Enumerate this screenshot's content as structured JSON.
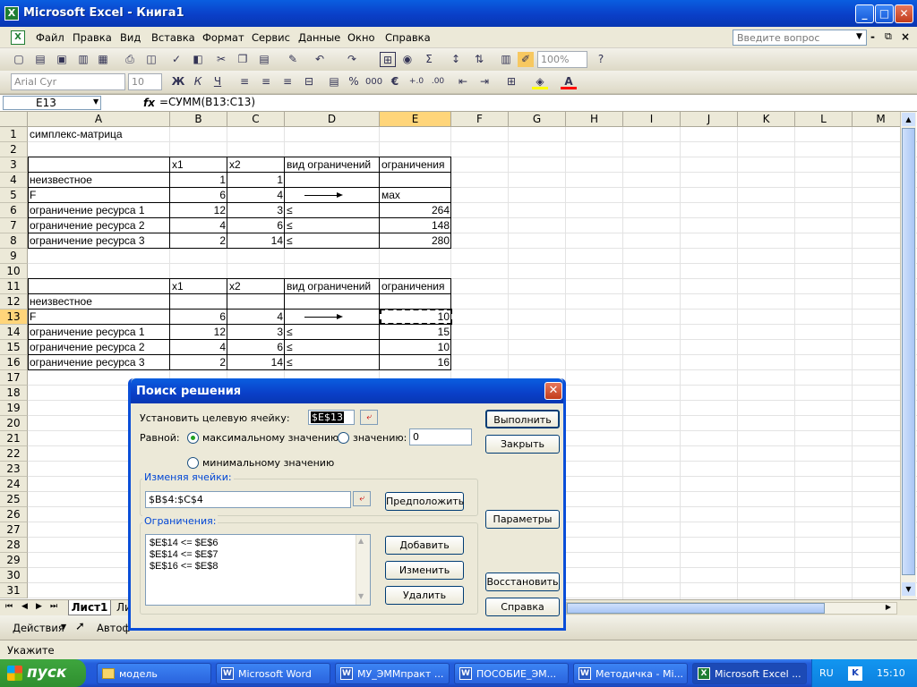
{
  "window": {
    "title": "Microsoft Excel - Книга1"
  },
  "menu": {
    "items": [
      "Файл",
      "Правка",
      "Вид",
      "Вставка",
      "Формат",
      "Сервис",
      "Данные",
      "Окно",
      "Справка"
    ],
    "help_placeholder": "Введите вопрос"
  },
  "toolbar": {
    "zoom": "100%",
    "font": "Arial Cyr",
    "size": "10"
  },
  "formula_bar": {
    "name_box": "E13",
    "fx": "fx",
    "formula": "=СУММ(B13:C13)"
  },
  "grid": {
    "columns": [
      "A",
      "B",
      "C",
      "D",
      "E",
      "F",
      "G",
      "H",
      "I",
      "J",
      "K",
      "L",
      "M"
    ],
    "rows": [
      "1",
      "2",
      "3",
      "4",
      "5",
      "6",
      "7",
      "8",
      "9",
      "10",
      "11",
      "12",
      "13",
      "14",
      "15",
      "16",
      "17",
      "18",
      "19",
      "20",
      "21",
      "22",
      "23",
      "24",
      "25",
      "26",
      "27",
      "28",
      "29",
      "30",
      "31"
    ],
    "selected_row": "13",
    "selected_col": "E",
    "cells": {
      "r1": {
        "a": "симплекс-матрица"
      },
      "r3": {
        "b": "x1",
        "c": "x2",
        "d": "вид ограничений",
        "e": "ограничения"
      },
      "r4": {
        "a": "неизвестное",
        "b": "1",
        "c": "1"
      },
      "r5": {
        "a": "F",
        "b": "6",
        "c": "4",
        "e": "мах"
      },
      "r6": {
        "a": "ограничение ресурса 1",
        "b": "12",
        "c": "3",
        "d": "≤",
        "e": "264"
      },
      "r7": {
        "a": "ограничение ресурса 2",
        "b": "4",
        "c": "6",
        "d": "≤",
        "e": "148"
      },
      "r8": {
        "a": "ограничение ресурса 3",
        "b": "2",
        "c": "14",
        "d": "≤",
        "e": "280"
      },
      "r11": {
        "b": "x1",
        "c": "x2",
        "d": "вид ограничений",
        "e": "ограничения"
      },
      "r12": {
        "a": "неизвестное"
      },
      "r13": {
        "a": "F",
        "b": "6",
        "c": "4",
        "e": "10"
      },
      "r14": {
        "a": "ограничение ресурса 1",
        "b": "12",
        "c": "3",
        "d": "≤",
        "e": "15"
      },
      "r15": {
        "a": "ограничение ресурса 2",
        "b": "4",
        "c": "6",
        "d": "≤",
        "e": "10"
      },
      "r16": {
        "a": "ограничение ресурса 3",
        "b": "2",
        "c": "14",
        "d": "≤",
        "e": "16"
      }
    }
  },
  "sheet_tabs": [
    "Лист1",
    "Ли"
  ],
  "draw_toolbar": {
    "actions": "Действия",
    "autoshapes": "Автоф"
  },
  "status": {
    "text": "Укажите"
  },
  "dialog": {
    "title": "Поиск решения",
    "target_label": "Установить целевую ячейку:",
    "target_value": "$E$13",
    "equal_label": "Равной:",
    "opt_max": "максимальному значению",
    "opt_value": "значению:",
    "value_field": "0",
    "opt_min": "минимальному значению",
    "changing_label": "Изменяя ячейки:",
    "changing_value": "$B$4:$C$4",
    "guess_button": "Предположить",
    "constraints_label": "Ограничения:",
    "constraints": [
      "$E$14 <= $E$6",
      "$E$14 <= $E$7",
      "$E$16 <= $E$8"
    ],
    "add_button": "Добавить",
    "change_button": "Изменить",
    "delete_button": "Удалить",
    "solve_button": "Выполнить",
    "close_button": "Закрыть",
    "options_button": "Параметры",
    "reset_button": "Восстановить",
    "help_button": "Справка"
  },
  "taskbar": {
    "start": "пуск",
    "tasks": [
      "модель",
      "Microsoft Word",
      "МУ_ЭММпракт ...",
      "ПОСОБИЕ_ЭМ...",
      "Методичка - Mi...",
      "Microsoft Excel ..."
    ],
    "lang": "RU",
    "clock": "15:10"
  },
  "colors": {
    "title_blue": "#0a4ed8",
    "selected_header": "#ffd57a",
    "start_green": "#2f8f2f"
  }
}
